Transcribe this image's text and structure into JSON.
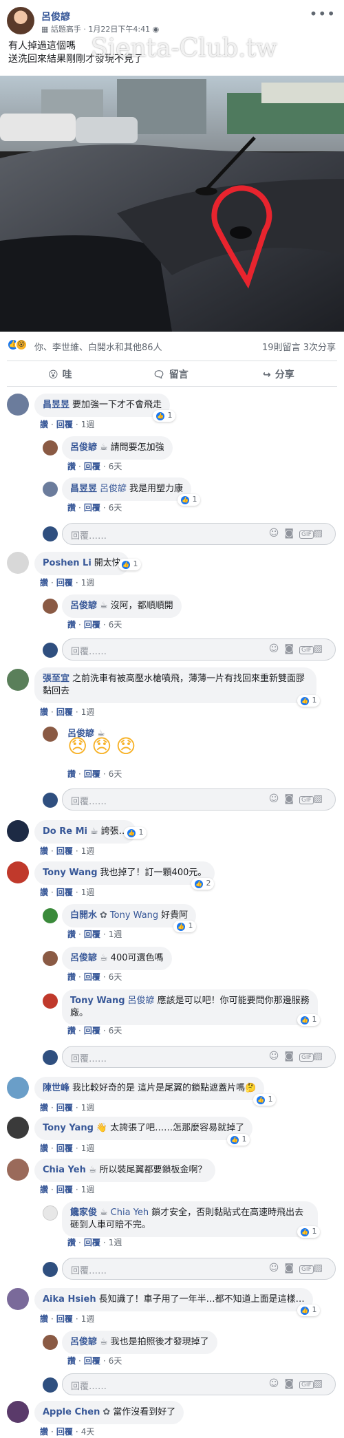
{
  "post": {
    "author": "呂俊諺",
    "badge": "話題高手",
    "time": "1月22日下午4:41",
    "line1": "有人掉過這個嗎",
    "line2": "送洗回來結果剛剛才發現不見了",
    "watermark": "Sienta-Club.tw"
  },
  "reactions": {
    "summary": "你、李世維、白開水和其他86人",
    "comments_count": "19則留言",
    "shares_count": "3次分享"
  },
  "actions": {
    "wow": "哇",
    "comment": "留言",
    "share": "分享"
  },
  "labels": {
    "like": "讚",
    "reply": "回覆",
    "reply_placeholder": "回覆……"
  },
  "comments": [
    {
      "name": "昌昱昱",
      "text": "要加強一下才不會飛走",
      "likes": "1",
      "time": "1週"
    },
    {
      "name": "呂俊諺",
      "badge": "☕",
      "text": "請問要怎加強",
      "time": "6天"
    },
    {
      "name": "昌昱昱",
      "tag": "呂俊諺",
      "text": "我是用塑力康",
      "likes": "1",
      "time": "6天"
    },
    {
      "name": "Poshen Li",
      "text": "開太快",
      "likes": "1",
      "time": "1週"
    },
    {
      "name": "呂俊諺",
      "badge": "☕",
      "text": "沒阿，都順順開",
      "time": "6天"
    },
    {
      "name": "張至宜",
      "text": "之前洗車有被高壓水槍噴飛，薄薄一片有找回來重新雙面膠黏回去",
      "likes": "1",
      "time": "1週"
    },
    {
      "name": "呂俊諺",
      "badge": "☕",
      "text": "😞😞😞",
      "time": "6天"
    },
    {
      "name": "Do Re Mi",
      "badge": "☕",
      "text": "誇張…",
      "likes": "1",
      "time": "1週"
    },
    {
      "name": "Tony Wang",
      "text": "我也掉了！訂一顆400元。",
      "likes": "2",
      "time": "1週"
    },
    {
      "name": "白開水",
      "badge": "✿",
      "tag": "Tony Wang",
      "text": "好貴阿",
      "likes": "1",
      "time": "1週"
    },
    {
      "name": "呂俊諺",
      "badge": "☕",
      "text": "400可選色嗎",
      "time": "6天"
    },
    {
      "name": "Tony Wang",
      "tag": "呂俊諺",
      "text": "應該是可以吧！你可能要問你那邊服務廠。",
      "likes": "1",
      "time": "6天"
    },
    {
      "name": "陳世峰",
      "text": "我比較好奇的是 這片是尾翼的鎖點遮蓋片嗎🤔",
      "likes": "1",
      "time": "1週"
    },
    {
      "name": "Tony Yang",
      "badge": "👋",
      "text": "太誇張了吧……怎那麼容易就掉了",
      "likes": "1",
      "time": "1週"
    },
    {
      "name": "Chia Yeh",
      "badge": "☕",
      "text": "所以裝尾翼都要鎖板金啊？",
      "time": "1週"
    },
    {
      "name": "饞家俊",
      "badge": "☕",
      "tag": "Chia Yeh",
      "text": "鎖才安全，否則黏貼式在高速時飛出去砸到人車可賠不完。",
      "likes": "1",
      "time": "1週"
    },
    {
      "name": "Aika Hsieh",
      "text": "長知識了！車子用了一年半…都不知道上面是這樣…",
      "likes": "1",
      "time": "1週"
    },
    {
      "name": "呂俊諺",
      "badge": "☕",
      "text": "我也是拍照後才發現掉了",
      "time": "6天"
    },
    {
      "name": "Apple Chen",
      "badge": "✿",
      "text": "當作沒看到好了",
      "time": "4天"
    }
  ],
  "icons": {
    "more": "more-dots-icon",
    "like": "thumbs-up-icon",
    "wow": "wow-face-icon",
    "comment": "comment-bubble-icon",
    "share": "share-arrow-icon"
  },
  "colors": {
    "link": "#385898",
    "fb_blue": "#1877f2",
    "bubble": "#f2f3f5",
    "highlight": "#e8242e"
  }
}
